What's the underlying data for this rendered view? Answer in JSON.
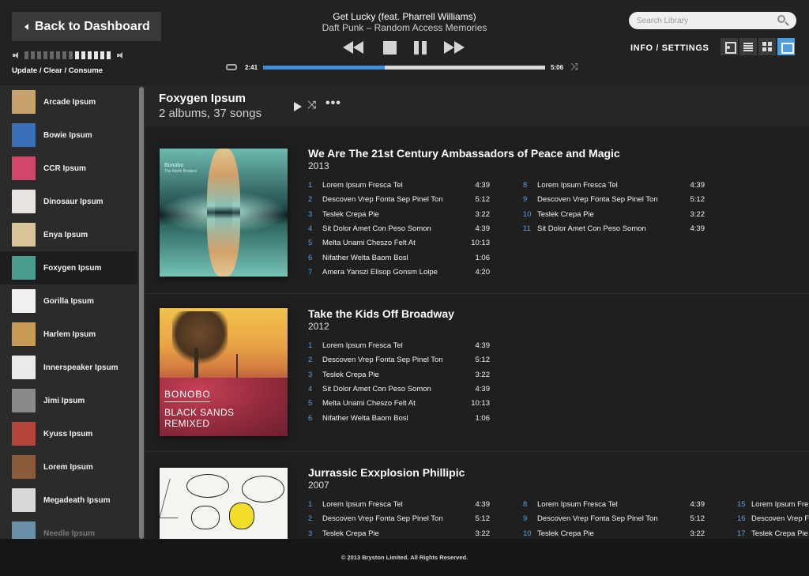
{
  "topbar": {
    "back_label": "Back to Dashboard",
    "queue_links": "Update / Clear / Consume",
    "volume_level_segments": 6,
    "volume_total_segments": 14,
    "now_playing": {
      "title": "Get Lucky (feat. Pharrell Williams)",
      "subtitle": "Daft Punk – Random Access Memories",
      "elapsed": "2:41",
      "total": "5:06",
      "progress_fraction": 0.43
    },
    "search": {
      "placeholder": "Search Library",
      "value": ""
    },
    "info_settings": "INFO / SETTINGS",
    "view_modes": [
      "music-icon",
      "list-icon",
      "grid-icon",
      "coverflow-icon"
    ],
    "active_view": "coverflow-icon"
  },
  "sidebar": {
    "artists": [
      {
        "name": "Arcade Ipsum",
        "thumb": "#c8a26b"
      },
      {
        "name": "Bowie Ipsum",
        "thumb": "#3b6fb8"
      },
      {
        "name": "CCR Ipsum",
        "thumb": "#d1466b"
      },
      {
        "name": "Dinosaur Ipsum",
        "thumb": "#e7e4df"
      },
      {
        "name": "Enya Ipsum",
        "thumb": "#d9c49a"
      },
      {
        "name": "Foxygen Ipsum",
        "thumb": "#4a9c8e"
      },
      {
        "name": "Gorilla Ipsum",
        "thumb": "#f0f0f0"
      },
      {
        "name": "Harlem Ipsum",
        "thumb": "#c79b56"
      },
      {
        "name": "Innerspeaker Ipsum",
        "thumb": "#eaeaea"
      },
      {
        "name": "Jimi Ipsum",
        "thumb": "#8a8a8a"
      },
      {
        "name": "Kyuss Ipsum",
        "thumb": "#b5453a"
      },
      {
        "name": "Lorem Ipsum",
        "thumb": "#8b5a3b"
      },
      {
        "name": "Megadeath Ipsum",
        "thumb": "#d8d8d8"
      },
      {
        "name": "Needle Ipsum",
        "thumb": "#6a8fa8"
      }
    ],
    "active_index": 5
  },
  "main": {
    "artist": "Foxygen Ipsum",
    "counts": "2 albums, 37 songs",
    "albums": [
      {
        "title": "We Are The 21st Century Ambassadors of Peace and Magic",
        "year": "2013",
        "cover_text": {
          "band": "Bonobo",
          "sub": "The North Borders"
        },
        "columns": [
          [
            [
              "1",
              "Lorem Ipsum Fresca Tel",
              "4:39"
            ],
            [
              "2",
              "Descoven Vrep Fonta Sep Pinel Ton",
              "5:12"
            ],
            [
              "3",
              "Teslek Crepa Pie",
              "3:22"
            ],
            [
              "4",
              "Sit Dolor Amet Con Peso Somon",
              "4:39"
            ],
            [
              "5",
              "Melta Unami Cheszo Felt At",
              "10:13"
            ],
            [
              "6",
              "Nifather Welta Baom Bosl",
              "1:06"
            ],
            [
              "7",
              "Amera Yanszi Elisop Gonsm Loipe",
              "4:20"
            ]
          ],
          [
            [
              "8",
              "Lorem Ipsum Fresca Tel",
              "4:39"
            ],
            [
              "9",
              "Descoven Vrep Fonta Sep Pinel Ton",
              "5:12"
            ],
            [
              "10",
              "Teslek Crepa Pie",
              "3:22"
            ],
            [
              "11",
              "Sit Dolor Amet Con Peso Somon",
              "4:39"
            ]
          ]
        ]
      },
      {
        "title": "Take the Kids Off Broadway",
        "year": "2012",
        "cover_text": {
          "band": "BONOBO",
          "line2": "BLACK SANDS",
          "line3": "REMIXED"
        },
        "columns": [
          [
            [
              "1",
              "Lorem Ipsum Fresca Tel",
              "4:39"
            ],
            [
              "2",
              "Descoven Vrep Fonta Sep Pinel Ton",
              "5:12"
            ],
            [
              "3",
              "Teslek Crepa Pie",
              "3:22"
            ],
            [
              "4",
              "Sit Dolor Amet Con Peso Somon",
              "4:39"
            ],
            [
              "5",
              "Melta Unami Cheszo Felt At",
              "10:13"
            ],
            [
              "6",
              "Nifather Welta Baom Bosl",
              "1:06"
            ]
          ]
        ]
      },
      {
        "title": "Jurrassic Exxplosion Phillipic",
        "year": "2007",
        "cover_text": {},
        "columns": [
          [
            [
              "1",
              "Lorem Ipsum Fresca Tel",
              "4:39"
            ],
            [
              "2",
              "Descoven Vrep Fonta Sep Pinel Ton",
              "5:12"
            ],
            [
              "3",
              "Teslek Crepa Pie",
              "3:22"
            ]
          ],
          [
            [
              "8",
              "Lorem Ipsum Fresca Tel",
              "4:39"
            ],
            [
              "9",
              "Descoven Vrep Fonta Sep Pinel Ton",
              "5:12"
            ],
            [
              "10",
              "Teslek Crepa Pie",
              "3:22"
            ]
          ],
          [
            [
              "15",
              "Lorem Ipsum Fre",
              ""
            ],
            [
              "16",
              "Descoven Vrep Fo",
              ""
            ],
            [
              "17",
              "Teslek Crepa Pie",
              ""
            ]
          ]
        ]
      }
    ]
  },
  "footer": {
    "copyright": "© 2013 Bryston Limited. All Rights Reserved."
  },
  "colors": {
    "accent": "#3f8fd9",
    "track_number": "#5aa2e6",
    "background": "#1c1c1c"
  }
}
